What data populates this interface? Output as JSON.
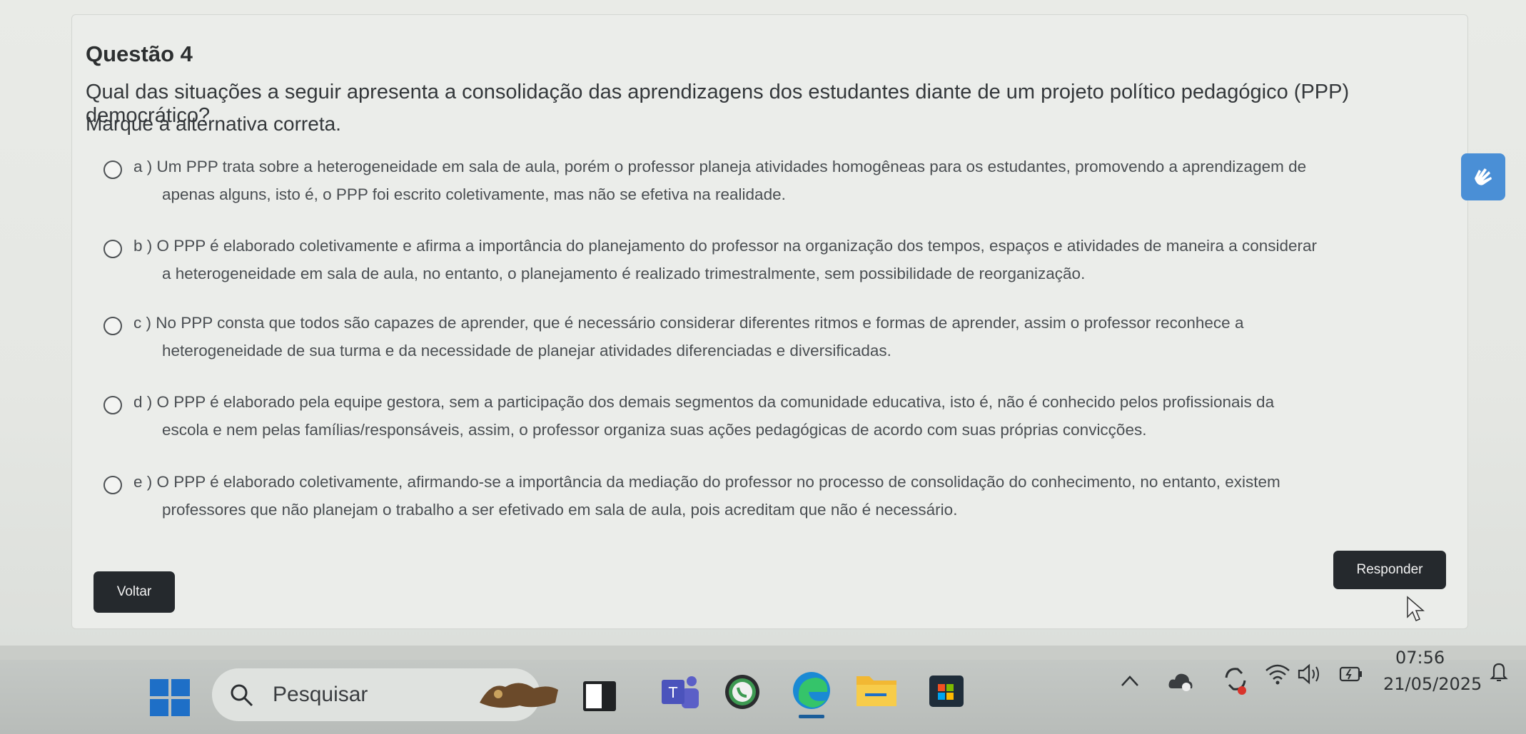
{
  "question": {
    "title": "Questão 4",
    "text": "Qual das situações a seguir apresenta a consolidação das aprendizagens dos estudantes diante de um projeto político pedagógico (PPP) democrático?",
    "instruction": "Marque a alternativa correta."
  },
  "options": [
    {
      "line1": "a ) Um PPP trata sobre a heterogeneidade em sala de aula, porém o professor planeja atividades homogêneas para os estudantes, promovendo a aprendizagem de",
      "line2": "apenas alguns, isto é, o PPP foi escrito coletivamente, mas não se efetiva na realidade."
    },
    {
      "line1": "b ) O PPP é elaborado coletivamente e afirma a importância do planejamento do professor na organização dos tempos, espaços e atividades de maneira a considerar",
      "line2": "a heterogeneidade em sala de aula, no entanto, o planejamento é realizado trimestralmente, sem possibilidade de reorganização."
    },
    {
      "line1": "c ) No PPP consta que todos são capazes de aprender, que é necessário considerar diferentes ritmos e formas de aprender, assim o professor reconhece a",
      "line2": "heterogeneidade de sua turma e da necessidade de planejar atividades diferenciadas e diversificadas."
    },
    {
      "line1": "d ) O PPP é elaborado pela equipe gestora, sem a participação dos demais segmentos da comunidade educativa, isto é, não é conhecido pelos profissionais da",
      "line2": "escola e nem pelas famílias/responsáveis, assim, o professor organiza suas ações pedagógicas de acordo com suas próprias convicções."
    },
    {
      "line1": "e ) O PPP é elaborado coletivamente, afirmando-se a importância da mediação do professor no processo de consolidação do conhecimento, no entanto, existem",
      "line2": "professores que não planejam o trabalho a ser efetivado em sala de aula, pois acreditam que não é necessário."
    }
  ],
  "buttons": {
    "back": "Voltar",
    "submit": "Responder"
  },
  "accessibility_icon": "hand-sign-icon",
  "taskbar": {
    "search_placeholder": "Pesquisar",
    "apps": [
      "windows-start-icon",
      "search-icon",
      "game-widget-icon",
      "folder-icon",
      "teams-icon",
      "whatsapp-icon",
      "edge-icon",
      "file-explorer-icon",
      "store-icon"
    ],
    "time": "07:56",
    "date": "21/05/2025"
  },
  "colors": {
    "button_bg": "#25292d",
    "accent": "#4a8fd6",
    "taskbar": "#bfc3c0"
  }
}
